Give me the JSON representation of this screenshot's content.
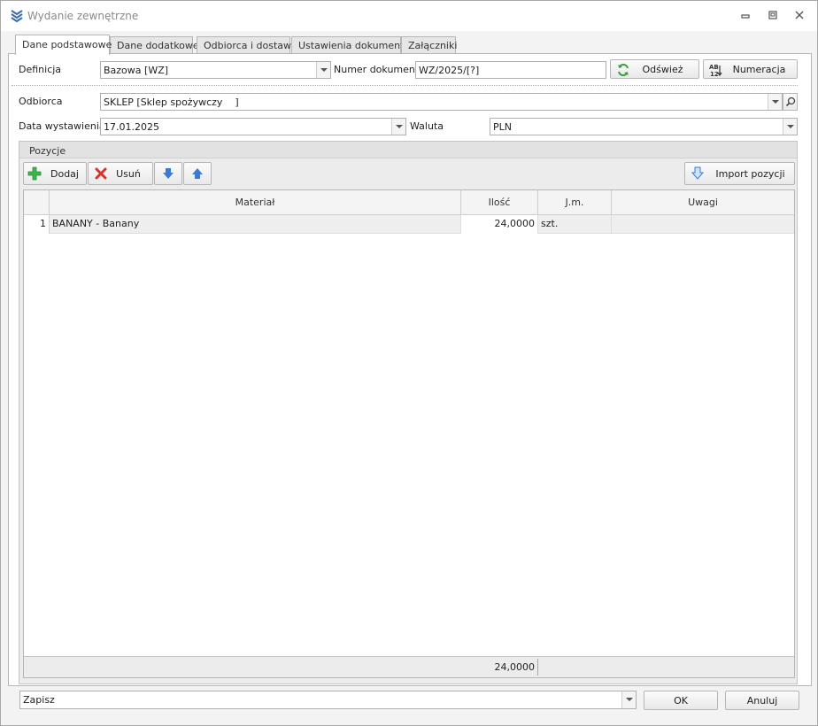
{
  "window": {
    "title": "Wydanie zewnętrzne"
  },
  "tabs": [
    "Dane podstawowe",
    "Dane dodatkowe",
    "Odbiorca i dostawa",
    "Ustawienia dokumentu",
    "Załączniki"
  ],
  "form": {
    "definicja_label": "Definicja",
    "definicja_value": "Bazowa [WZ]",
    "numer_label": "Numer dokumentu",
    "numer_value": "WZ/2025/[?]",
    "odswiez_label": "Odśwież",
    "numeracja_label": "Numeracja",
    "odbiorca_label": "Odbiorca",
    "odbiorca_value": "SKLEP [Sklep spożywczy    ]",
    "data_label": "Data wystawienia",
    "data_value": "17.01.2025",
    "waluta_label": "Waluta",
    "waluta_value": "PLN"
  },
  "positions": {
    "title": "Pozycje",
    "dodaj_label": "Dodaj",
    "usun_label": "Usuń",
    "import_label": "Import pozycji",
    "columns": [
      "Materiał",
      "Ilość",
      "J.m.",
      "Uwagi"
    ],
    "rows": [
      {
        "num": "1",
        "material": "BANANY - Banany",
        "ilosc": "24,0000",
        "jm": "szt.",
        "uwagi": ""
      }
    ],
    "total_ilosc": "24,0000"
  },
  "footer": {
    "action_value": "Zapisz",
    "ok_label": "OK",
    "cancel_label": "Anuluj"
  },
  "colors": {
    "accent_blue": "#3a7bd5",
    "add_green": "#3bb54a",
    "delete_red": "#d9322b"
  }
}
